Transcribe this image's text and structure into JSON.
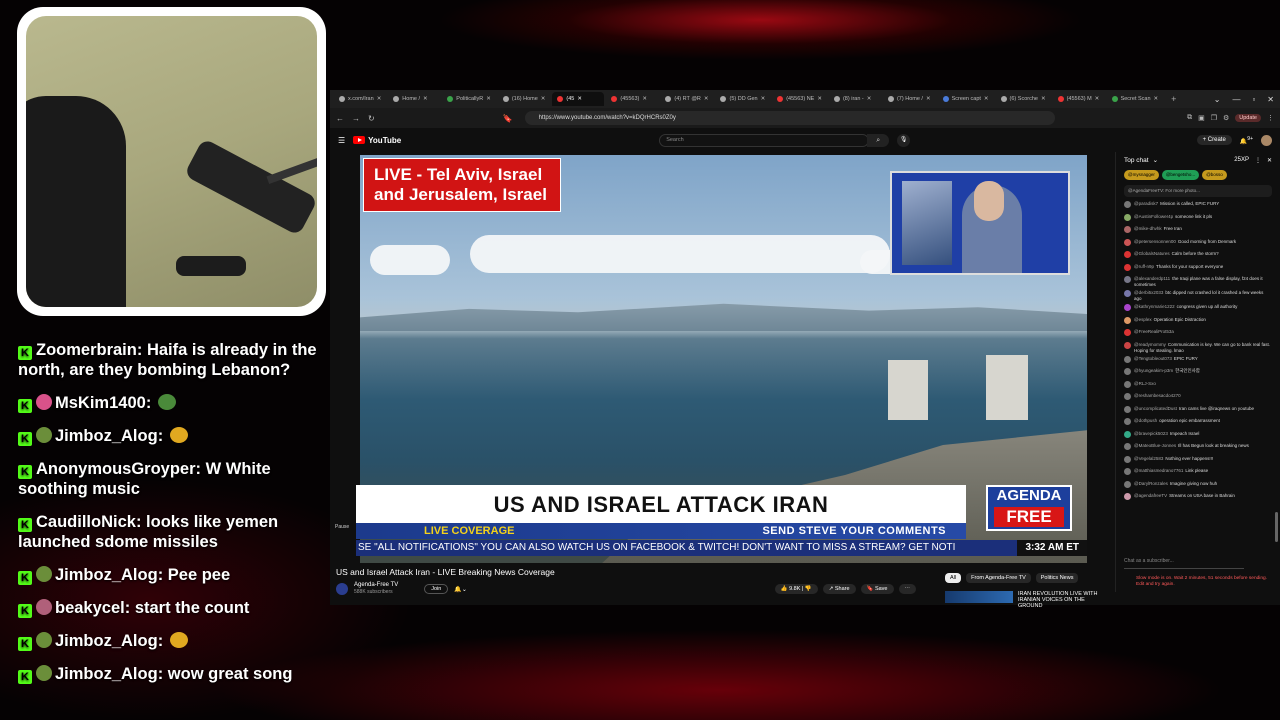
{
  "stream_chat": [
    {
      "user": "Zoomerbrain",
      "text": "Haifa is already in the north, are they bombing Lebanon?",
      "avatar_color": "",
      "emote": false
    },
    {
      "user": "MsKim1400",
      "text": "",
      "avatar_color": "#d9528a",
      "emote": true,
      "emote_color": "#4a8a3a"
    },
    {
      "user": "Jimboz_Alog",
      "text": "",
      "avatar_color": "#6b8e3a",
      "emote": true,
      "emote_color": "#e0a820"
    },
    {
      "user": "AnonymousGroyper",
      "text": "W White soothing music",
      "avatar_color": "",
      "emote": false
    },
    {
      "user": "CaudilloNick",
      "text": "looks like yemen launched sdome missiles",
      "avatar_color": "",
      "emote": false
    },
    {
      "user": "Jimboz_Alog",
      "text": "Pee pee",
      "avatar_color": "#6b8e3a",
      "emote": false
    },
    {
      "user": "beakycel",
      "text": "start the count",
      "avatar_color": "#b0607a",
      "emote": false
    },
    {
      "user": "Jimboz_Alog",
      "text": "",
      "avatar_color": "#6b8e3a",
      "emote": true,
      "emote_color": "#e0a820"
    },
    {
      "user": "Jimboz_Alog",
      "text": "wow great song",
      "avatar_color": "#6b8e3a",
      "emote": false
    }
  ],
  "browser": {
    "tabs": [
      {
        "label": "x.com/Iran",
        "favicon": "#aaa"
      },
      {
        "label": "Home /",
        "favicon": "#aaa"
      },
      {
        "label": "PoliticallyR",
        "favicon": "#3aa34a"
      },
      {
        "label": "(16) Home",
        "favicon": "#aaa"
      },
      {
        "label": "(45",
        "favicon": "#e33",
        "active": true
      },
      {
        "label": "(45563)",
        "favicon": "#e33"
      },
      {
        "label": "(4) RT @R",
        "favicon": "#aaa"
      },
      {
        "label": "(5) DD Gen",
        "favicon": "#aaa"
      },
      {
        "label": "(45563) NE",
        "favicon": "#e33"
      },
      {
        "label": "(8) iran -",
        "favicon": "#aaa"
      },
      {
        "label": "(7) Home /",
        "favicon": "#aaa"
      },
      {
        "label": "Screen capt",
        "favicon": "#4a7bd9"
      },
      {
        "label": "(6) Scorche",
        "favicon": "#aaa"
      },
      {
        "label": "(45563) M",
        "favicon": "#e33"
      },
      {
        "label": "Secret Scan",
        "favicon": "#3aa34a"
      }
    ],
    "url": "https://www.youtube.com/watch?v=kDQrHCRs0Z0y",
    "update_label": "Update"
  },
  "youtube": {
    "logo_text": "YouTube",
    "search_placeholder": "Search",
    "create_label": "+ Create",
    "notif_count": "9+"
  },
  "video": {
    "live_label_line1": "LIVE - Tel Aviv, Israel",
    "live_label_line2": "and Jerusalem, Israel",
    "headline": "US AND ISRAEL ATTACK IRAN",
    "strap_left": "LIVE COVERAGE",
    "strap_right": "SEND STEVE YOUR COMMENTS",
    "brand_top": "AGENDA",
    "brand_bottom": "FREE",
    "ticker": "SE \"ALL NOTIFICATIONS\"    YOU CAN ALSO WATCH US ON FACEBOOK & TWITCH!    DON'T WANT TO MISS A STREAM? GET NOTI",
    "time": "3:32 AM ET",
    "pause_label": "Pause"
  },
  "below_video": {
    "title": "US and Israel Attack Iran - LIVE Breaking News Coverage",
    "channel": "Agenda-Free TV",
    "subs": "588K subscribers",
    "join": "Join",
    "likes": "9.8K",
    "share": "Share",
    "save": "Save",
    "chips": [
      "All",
      "From Agenda-Free TV",
      "Politics News"
    ],
    "rec_title": "IRAN REVOLUTION LIVE WITH IRANIAN VOICES ON THE GROUND"
  },
  "live_chat": {
    "header": "Top chat",
    "viewer_badge": "25XP",
    "donors": [
      "@mysnagger",
      "@bengetsho...",
      "@bosso"
    ],
    "pinned": "@AgendaFreeTV: For more photo...",
    "messages": [
      {
        "user": "@paradisk7",
        "text": "Mission is called, EPIC FURY",
        "color": "#777"
      },
      {
        "user": "@AustinFollower4p",
        "text": "someone link it pls",
        "color": "#8a6"
      },
      {
        "user": "@mike-dhvhk",
        "text": "Free Iran",
        "color": "#a66"
      },
      {
        "user": "@petersensonnen00",
        "text": "Good morning from Denmark",
        "color": "#c55"
      },
      {
        "user": "@GlobalsNatures",
        "text": "Calm before the storm?",
        "color": "#d33"
      },
      {
        "user": "@ruff-n9p",
        "text": "Thanks for your support everyone",
        "color": "#d33"
      },
      {
        "user": "@alexanderdp111",
        "text": "the Iraqi plane was a false display, f24 does it sometimes",
        "color": "#778"
      },
      {
        "user": "@derbi5x2033",
        "text": "btc dipped not crashed lol it crashed a few weeks ago",
        "color": "#77a"
      },
      {
        "user": "@kathrynmarie1222",
        "text": "congress given up all authority",
        "color": "#a4c"
      },
      {
        "user": "@esplex",
        "text": "Operation Epic Distraction",
        "color": "#d96"
      },
      {
        "user": "@FreeRealiProt53a",
        "text": "",
        "color": "#d33"
      },
      {
        "user": "@readymommy",
        "text": "Communication is key. We can go to bank real fast. Hoping for stealing. lmao",
        "color": "#c44"
      },
      {
        "user": "@Tengtobleout073",
        "text": "EPIC FURY",
        "color": "#777"
      },
      {
        "user": "@hyungeakim-p3m",
        "text": "한국인인사함",
        "color": "#777"
      },
      {
        "user": "@RLJ-Sxo",
        "text": "",
        "color": "#777"
      },
      {
        "user": "@reshambesacdo4270",
        "text": "",
        "color": "#777"
      },
      {
        "user": "@uncomplicatedDust",
        "text": "Iran cams live @iraqnews on youtube",
        "color": "#777"
      },
      {
        "user": "@dothpush",
        "text": "operation epic embarrassment",
        "color": "#777"
      },
      {
        "user": "@bravepick5023",
        "text": "Impeach Israel",
        "color": "#3a8"
      },
      {
        "user": "@MateoBlue-Jonnes",
        "text": "Ill has Begun look at breaking news",
        "color": "#777"
      },
      {
        "user": "@Vegelal2583",
        "text": "Nothing ever happens!!!",
        "color": "#777"
      },
      {
        "user": "@matthiasmedrano7761",
        "text": "Link please",
        "color": "#777"
      },
      {
        "user": "@DarylRonzales",
        "text": "Imagine giving now huh",
        "color": "#777"
      },
      {
        "user": "@agendafreeTV",
        "text": "Streams on USA base in Bahrain",
        "color": "#c9a"
      }
    ],
    "input_placeholder": "Chat as a subscriber...",
    "slow_mode": "Slow mode is on. Wait 2 minutes, 51 seconds before sending. Edit and try again."
  }
}
